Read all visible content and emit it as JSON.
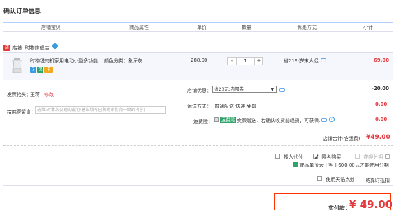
{
  "page": {
    "title": "确认订单信息"
  },
  "table_headers": [
    "店铺宝贝",
    "商品属性",
    "单价",
    "数量",
    "优惠方式",
    "小计"
  ],
  "shop": {
    "badge": "店",
    "name": "店铺: 时物旗舰店"
  },
  "product": {
    "name": "时物锐肉机家用电动小型多功能...",
    "attr": "颜色分类：象牙灰",
    "price": "288.00",
    "qty": "1",
    "qty_minus": "-",
    "qty_plus": "+",
    "discount": "省219:岁末大促",
    "subtotal": "69.00",
    "badges": [
      "7",
      "保",
      "卡"
    ]
  },
  "invoice": {
    "label": "发票抬头：",
    "value": "王蒋",
    "edit": "修改"
  },
  "message": {
    "label": "给卖家留言：",
    "placeholder": "选填:对本次交易的说明(建议填写已和卖家协商一致的内容)"
  },
  "shop_coupon": {
    "label": "店铺优惠：",
    "selected": "省20元:内部券",
    "amount": "-20.00"
  },
  "shipping": {
    "label": "运送方式：",
    "value": "普通配送 快递 免邮",
    "amount": "0.00"
  },
  "insurance": {
    "label": "运费险：",
    "tag": "运费险",
    "text": "卖家赠送，若确认收货前退货，可获保...",
    "amount": "0.00"
  },
  "shop_total": {
    "label": "店铺合计(含运费)",
    "value": "¥49.00"
  },
  "options": {
    "agent_pay": "找人代付",
    "anonymous": "匿名购买",
    "installment": "花呗分期",
    "installment_note": "商品单价大于等于600.00元才能使用分期",
    "tmall_points": "使用天猫点券",
    "points_note": "结算时抵扣"
  },
  "pay": {
    "label": "实付款：",
    "value": "¥ 49.00"
  }
}
